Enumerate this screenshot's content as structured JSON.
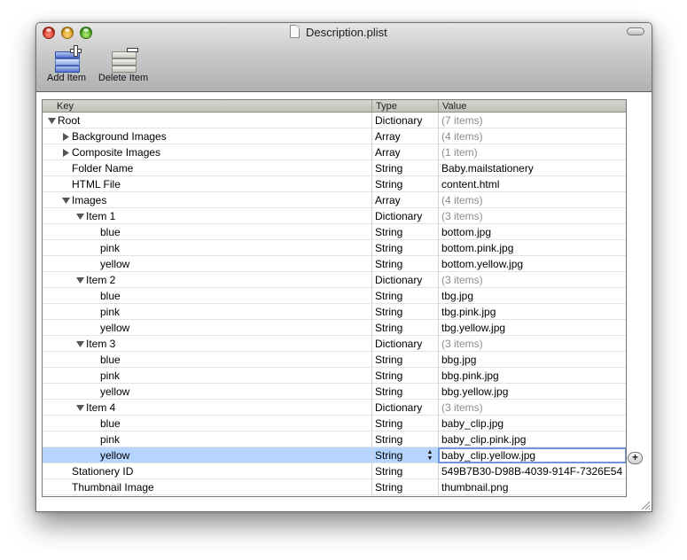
{
  "window": {
    "title": "Description.plist"
  },
  "toolbar": {
    "add_label": "Add Item",
    "delete_label": "Delete Item"
  },
  "columns": {
    "key": "Key",
    "type": "Type",
    "value": "Value"
  },
  "rows": [
    {
      "key": "Root",
      "type": "Dictionary",
      "value": "(7 items)",
      "level": 0,
      "disclosure": "open",
      "muted": true
    },
    {
      "key": "Background Images",
      "type": "Array",
      "value": "(4 items)",
      "level": 1,
      "disclosure": "closed",
      "muted": true
    },
    {
      "key": "Composite Images",
      "type": "Array",
      "value": "(1 item)",
      "level": 1,
      "disclosure": "closed",
      "muted": true
    },
    {
      "key": "Folder Name",
      "type": "String",
      "value": "Baby.mailstationery",
      "level": 1,
      "disclosure": "none",
      "muted": false
    },
    {
      "key": "HTML File",
      "type": "String",
      "value": "content.html",
      "level": 1,
      "disclosure": "none",
      "muted": false
    },
    {
      "key": "Images",
      "type": "Array",
      "value": "(4 items)",
      "level": 1,
      "disclosure": "open",
      "muted": true
    },
    {
      "key": "Item 1",
      "type": "Dictionary",
      "value": "(3 items)",
      "level": 2,
      "disclosure": "open",
      "muted": true
    },
    {
      "key": "blue",
      "type": "String",
      "value": "bottom.jpg",
      "level": 3,
      "disclosure": "none",
      "muted": false
    },
    {
      "key": "pink",
      "type": "String",
      "value": "bottom.pink.jpg",
      "level": 3,
      "disclosure": "none",
      "muted": false
    },
    {
      "key": "yellow",
      "type": "String",
      "value": "bottom.yellow.jpg",
      "level": 3,
      "disclosure": "none",
      "muted": false
    },
    {
      "key": "Item 2",
      "type": "Dictionary",
      "value": "(3 items)",
      "level": 2,
      "disclosure": "open",
      "muted": true
    },
    {
      "key": "blue",
      "type": "String",
      "value": "tbg.jpg",
      "level": 3,
      "disclosure": "none",
      "muted": false
    },
    {
      "key": "pink",
      "type": "String",
      "value": "tbg.pink.jpg",
      "level": 3,
      "disclosure": "none",
      "muted": false
    },
    {
      "key": "yellow",
      "type": "String",
      "value": "tbg.yellow.jpg",
      "level": 3,
      "disclosure": "none",
      "muted": false
    },
    {
      "key": "Item 3",
      "type": "Dictionary",
      "value": "(3 items)",
      "level": 2,
      "disclosure": "open",
      "muted": true
    },
    {
      "key": "blue",
      "type": "String",
      "value": "bbg.jpg",
      "level": 3,
      "disclosure": "none",
      "muted": false
    },
    {
      "key": "pink",
      "type": "String",
      "value": "bbg.pink.jpg",
      "level": 3,
      "disclosure": "none",
      "muted": false
    },
    {
      "key": "yellow",
      "type": "String",
      "value": "bbg.yellow.jpg",
      "level": 3,
      "disclosure": "none",
      "muted": false
    },
    {
      "key": "Item 4",
      "type": "Dictionary",
      "value": "(3 items)",
      "level": 2,
      "disclosure": "open",
      "muted": true
    },
    {
      "key": "blue",
      "type": "String",
      "value": "baby_clip.jpg",
      "level": 3,
      "disclosure": "none",
      "muted": false
    },
    {
      "key": "pink",
      "type": "String",
      "value": "baby_clip.pink.jpg",
      "level": 3,
      "disclosure": "none",
      "muted": false
    },
    {
      "key": "yellow",
      "type": "String",
      "value": "baby_clip.yellow.jpg",
      "level": 3,
      "disclosure": "none",
      "muted": false,
      "selected": true,
      "editing": true
    },
    {
      "key": "Stationery ID",
      "type": "String",
      "value": "549B7B30-D98B-4039-914F-7326E54",
      "level": 1,
      "disclosure": "none",
      "muted": false
    },
    {
      "key": "Thumbnail Image",
      "type": "String",
      "value": "thumbnail.png",
      "level": 1,
      "disclosure": "none",
      "muted": false
    }
  ],
  "icons": {
    "close": "close-icon",
    "minimize": "minimize-icon",
    "zoom": "zoom-icon",
    "document": "document-icon",
    "toolbar_toggle": "toolbar-toggle-icon",
    "add_item": "add-item-icon",
    "delete_item": "delete-item-icon",
    "disclosure_open": "disclosure-open-icon",
    "disclosure_closed": "disclosure-closed-icon",
    "stepper": "type-stepper-icon",
    "add_row": "add-row-icon",
    "resize": "resize-grip-icon"
  },
  "add_row_glyph": "+",
  "stepper_up": "▲",
  "stepper_down": "▼",
  "colors": {
    "selection": "#b5d5ff",
    "muted_text": "#8c8c8c"
  }
}
